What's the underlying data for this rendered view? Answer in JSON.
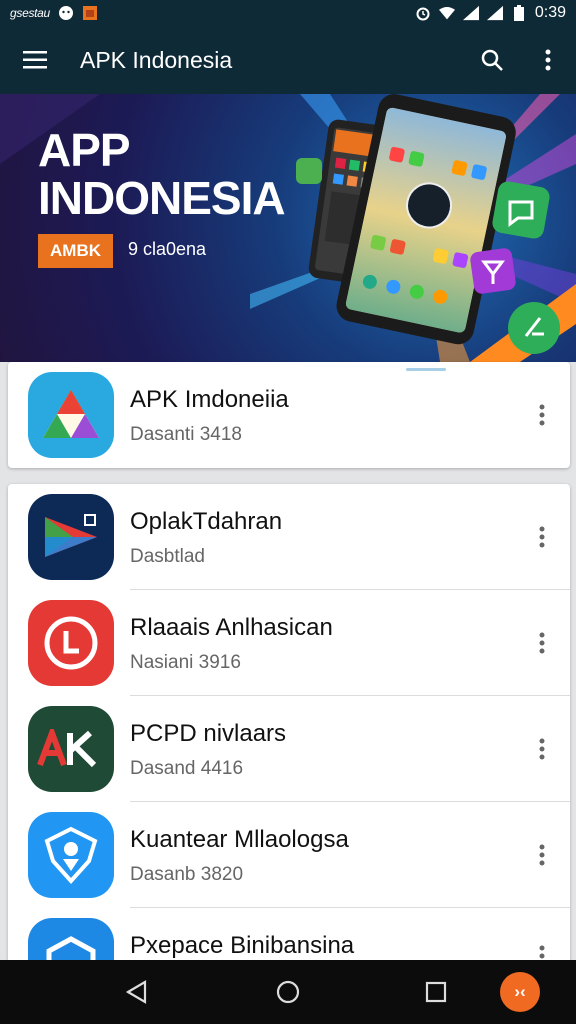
{
  "status_bar": {
    "carrier": "gsestau",
    "time": "0:39",
    "icons": [
      "face-icon",
      "gallery-icon",
      "alarm-icon",
      "wifi-icon",
      "signal-icon",
      "battery-icon"
    ]
  },
  "app_bar": {
    "title": "APK Indonesia",
    "icons": [
      "menu-icon",
      "search-icon",
      "more-vert-icon"
    ]
  },
  "banner": {
    "title_line1": "APP",
    "title_line2": "INDONESIA",
    "badge": "AMBK",
    "subtitle": "9 cla0ena"
  },
  "featured": {
    "name": "APK Imdoneiia",
    "subtitle": "Dasanti 3418",
    "icon": "drive-triangle-icon",
    "colors": {
      "bg": "#29a9e0"
    }
  },
  "list": [
    {
      "name": "OplakTdahran",
      "subtitle": "Dasbtlad",
      "icon": "play-arrow-icon",
      "color": "#0d2a57"
    },
    {
      "name": "Rlaaais Anlhasican",
      "subtitle": "Nasiani 3916",
      "icon": "clock-letter-icon",
      "color": "#e53935"
    },
    {
      "name": "PCPD nivlaars",
      "subtitle": "Dasand 4416",
      "icon": "ak-logo-icon",
      "color": "#1f4a36"
    },
    {
      "name": "Kuantear Mllaologsa",
      "subtitle": "Dasanb 3820",
      "icon": "shield-face-icon",
      "color": "#2196f3"
    },
    {
      "name": "Pxepace Binibansina",
      "subtitle": "",
      "icon": "cube-icon",
      "color": "#1e88e5"
    }
  ],
  "nav_bar": {
    "icons": [
      "back-icon",
      "home-icon",
      "recents-icon"
    ],
    "badge_text": "›‹"
  }
}
